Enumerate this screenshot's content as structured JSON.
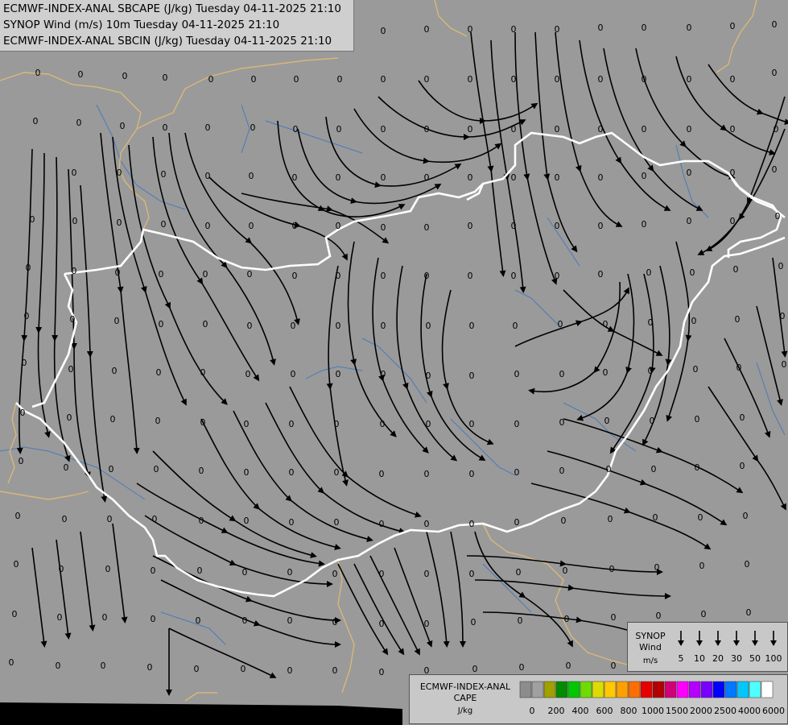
{
  "titles": {
    "line1": "ECMWF-INDEX-ANAL SBCAPE (J/kg) Tuesday 04-11-2025 21:10",
    "line2": "SYNOP Wind (m/s) 10m Tuesday 04-11-2025 21:10",
    "line3": "ECMWF-INDEX-ANAL SBCIN (J/kg) Tuesday 04-11-2025 21:10"
  },
  "wind_legend": {
    "title_line1": "SYNOP",
    "title_line2": "Wind",
    "title_line3": "m/s",
    "speeds": [
      "5",
      "10",
      "20",
      "30",
      "50",
      "100"
    ]
  },
  "cape_legend": {
    "title_line1": "ECMWF-INDEX-ANAL",
    "title_line2": "CAPE",
    "title_line3": "J/kg",
    "colors": [
      "#8c8c8c",
      "#a0a0a0",
      "#a0a000",
      "#008c00",
      "#00c800",
      "#6edc00",
      "#dcdc00",
      "#ffc800",
      "#ffa000",
      "#ff6e00",
      "#e60000",
      "#b40000",
      "#d20078",
      "#ff00ff",
      "#b400ff",
      "#7800ff",
      "#0000ff",
      "#0078ff",
      "#00c8ff",
      "#50ffff",
      "#ffffff"
    ],
    "labels": [
      "0",
      "200",
      "400",
      "600",
      "800",
      "1000",
      "1500",
      "2000",
      "2500",
      "4000",
      "6000"
    ]
  },
  "field_value": "0",
  "colors": {
    "background": "#9a9a9a",
    "border_national": "#ffffff",
    "border_regional": "#d8b878",
    "rivers": "#4b7ab8",
    "streamlines": "#000000"
  }
}
